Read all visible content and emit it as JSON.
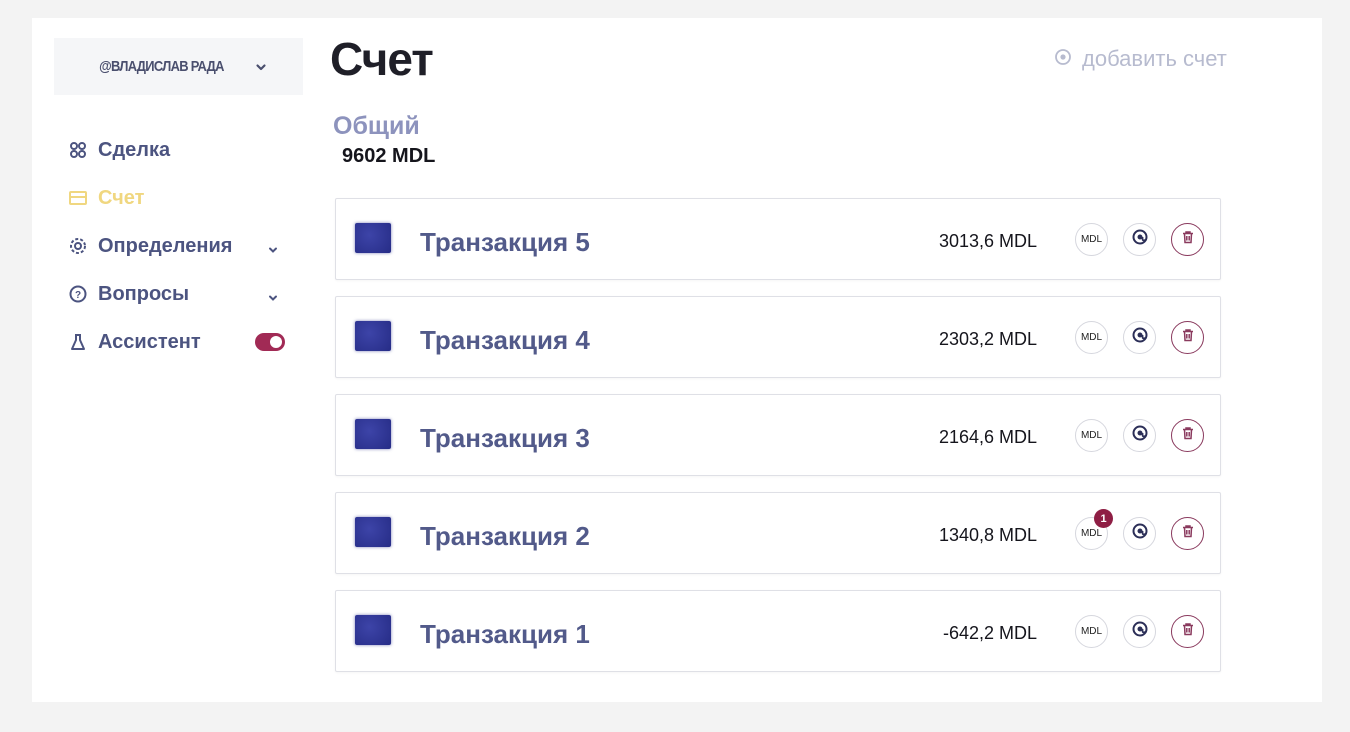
{
  "user": {
    "name": "@ВЛАДИСЛАВ РАДА"
  },
  "sidebar": {
    "items": [
      {
        "label": "Сделка",
        "icon": "grid-icon",
        "active": false,
        "has_chevron": false
      },
      {
        "label": "Счет",
        "icon": "wallet-icon",
        "active": true,
        "has_chevron": false
      },
      {
        "label": "Определения",
        "icon": "settings-icon",
        "active": false,
        "has_chevron": true
      },
      {
        "label": "Вопросы",
        "icon": "question-icon",
        "active": false,
        "has_chevron": true
      },
      {
        "label": "Ассистент",
        "icon": "flask-icon",
        "active": false,
        "has_toggle": true,
        "toggle_on": true
      }
    ]
  },
  "header": {
    "title": "Счет",
    "add_label": "добавить счет"
  },
  "total": {
    "label": "Общий",
    "value": "9602 MDL"
  },
  "transactions": [
    {
      "name": "Транзакция 5",
      "amount": "3013,6 MDL",
      "currency_label": "MDL",
      "badge": null
    },
    {
      "name": "Транзакция 4",
      "amount": "2303,2 MDL",
      "currency_label": "MDL",
      "badge": null
    },
    {
      "name": "Транзакция 3",
      "amount": "2164,6 MDL",
      "currency_label": "MDL",
      "badge": null
    },
    {
      "name": "Транзакция 2",
      "amount": "1340,8 MDL",
      "currency_label": "MDL",
      "badge": "1"
    },
    {
      "name": "Транзакция 1",
      "amount": "-642,2 MDL",
      "currency_label": "MDL",
      "badge": null
    }
  ],
  "colors": {
    "accent_active": "#f0d780",
    "nav_text": "#4c5480",
    "toggle": "#a12a55",
    "badge": "#8e1e44",
    "delete": "#8a3a5e"
  }
}
